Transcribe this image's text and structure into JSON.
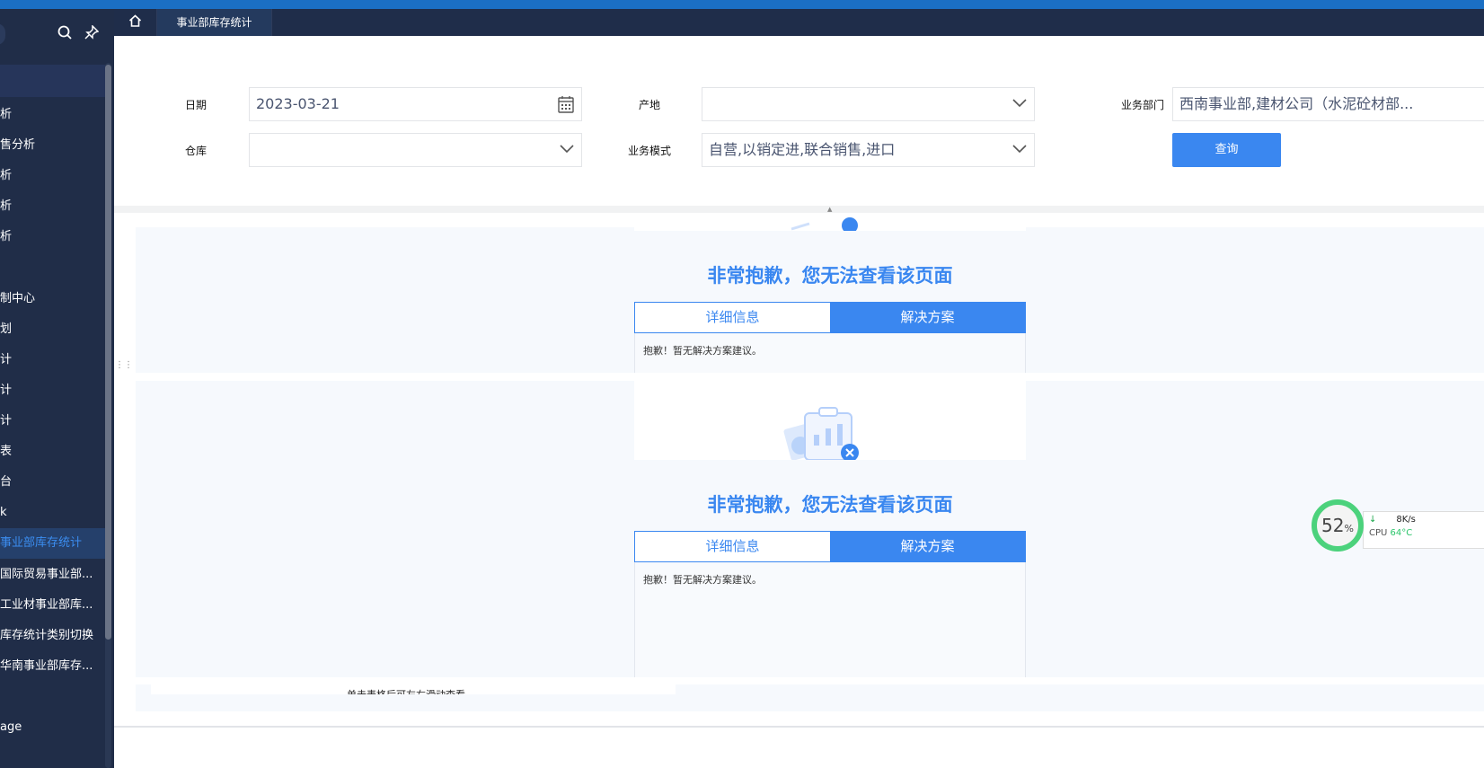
{
  "window": {
    "accent": "#1b6fc4"
  },
  "sidebar": {
    "items": [
      {
        "label": "析"
      },
      {
        "label": "售分析"
      },
      {
        "label": "析"
      },
      {
        "label": "析"
      },
      {
        "label": "析"
      },
      {
        "label": ""
      },
      {
        "label": "制中心"
      },
      {
        "label": "划"
      },
      {
        "label": "计"
      },
      {
        "label": "计"
      },
      {
        "label": "计"
      },
      {
        "label": "表"
      },
      {
        "label": "台"
      },
      {
        "label": "k"
      },
      {
        "label": "事业部库存统计",
        "active": true
      },
      {
        "label": "国际贸易事业部..."
      },
      {
        "label": "工业材事业部库..."
      },
      {
        "label": "库存统计类别切换"
      },
      {
        "label": "华南事业部库存..."
      },
      {
        "label": ""
      },
      {
        "label": "age"
      }
    ]
  },
  "tabs": {
    "active": "事业部库存统计"
  },
  "filters": {
    "date_label": "日期",
    "date_value": "2023-03-21",
    "origin_label": "产地",
    "origin_value": "",
    "dept_label": "业务部门",
    "dept_value": "西南事业部,建材公司（水泥砼材部...",
    "warehouse_label": "仓库",
    "warehouse_value": "",
    "mode_label": "业务模式",
    "mode_value": "自营,以销定进,联合销售,进口",
    "query_button": "查询"
  },
  "errors": [
    {
      "title": "非常抱歉，您无法查看该页面",
      "tab_details": "详细信息",
      "tab_solution": "解决方案",
      "message": "抱歉！暂无解决方案建议。"
    },
    {
      "title": "非常抱歉，您无法查看该页面",
      "tab_details": "详细信息",
      "tab_solution": "解决方案",
      "message": "抱歉！暂无解决方案建议。"
    }
  ],
  "footer_hint": "单击表格后可左右滑动查看",
  "monitor": {
    "percent": "52",
    "percent_unit": "%",
    "net": "8K/s",
    "cpu_label": "CPU",
    "cpu_temp": "64°C"
  }
}
